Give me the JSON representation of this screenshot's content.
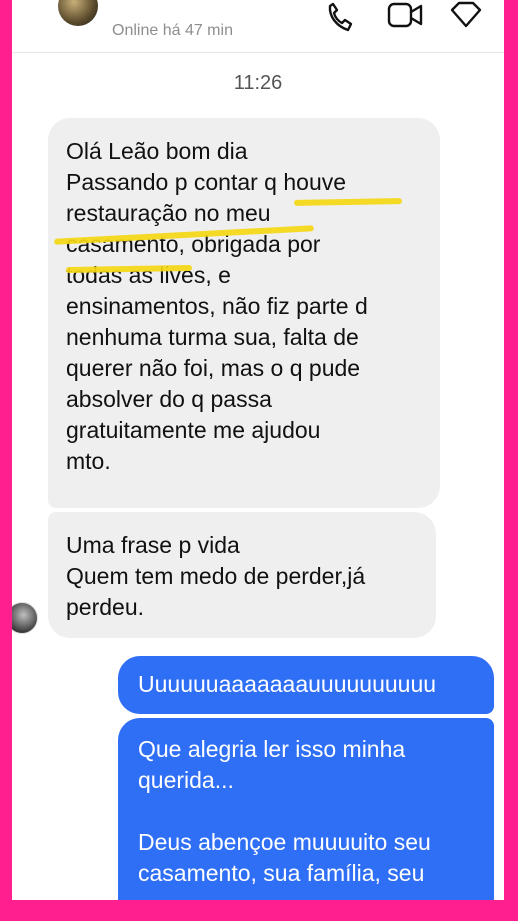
{
  "header": {
    "status": "Online há 47 min",
    "call_icon": "phone-icon",
    "video_icon": "video-icon",
    "flag_icon": "flag-icon"
  },
  "timestamp": "11:26",
  "messages": [
    {
      "direction": "incoming",
      "lines": [
        "Olá Leão bom dia",
        "Passando p contar q houve",
        "restauração no meu",
        "casamento, obrigada por",
        "todas as lives, e",
        "ensinamentos, não fiz parte d",
        "nenhuma turma sua, falta de",
        "querer não foi, mas o q pude",
        "absolver do q passa",
        "gratuitamente me ajudou",
        "mto."
      ]
    },
    {
      "direction": "incoming",
      "lines": [
        "Uma frase p vida",
        "Quem tem medo de perder,já",
        "perdeu."
      ]
    },
    {
      "direction": "outgoing",
      "lines": [
        "Uuuuuuaaaaaaauuuuuuuuuu"
      ]
    },
    {
      "direction": "outgoing",
      "lines": [
        "Que alegria ler isso minha",
        "querida...",
        "",
        "Deus abençoe muuuuito seu",
        "casamento, sua família, seu"
      ]
    }
  ],
  "colors": {
    "frame": "#ff1f8e",
    "incoming_bubble": "#efefef",
    "outgoing_bubble": "#2f6ff5",
    "highlight": "#f4d714"
  }
}
